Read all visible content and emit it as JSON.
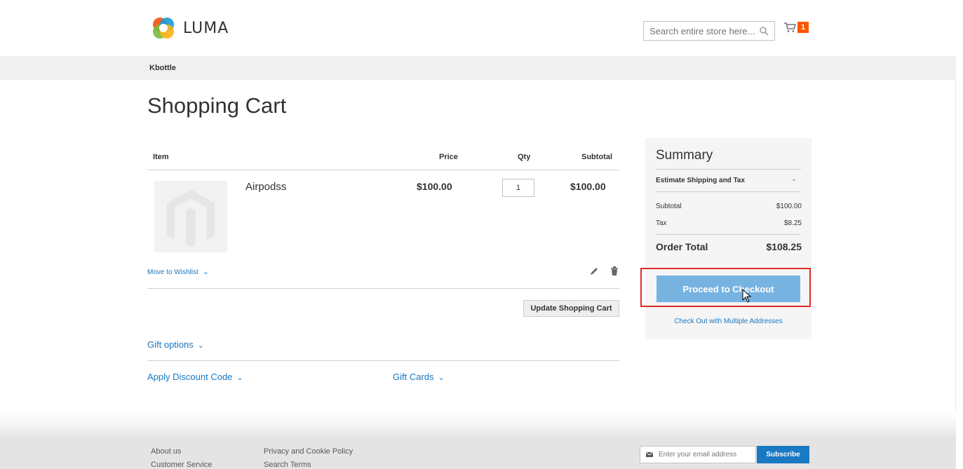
{
  "header": {
    "logo_text": "LUMA",
    "search_placeholder": "Search entire store here...",
    "cart_count": "1"
  },
  "nav": {
    "items": [
      "Kbottle"
    ]
  },
  "page": {
    "title": "Shopping Cart"
  },
  "cart": {
    "columns": [
      "Item",
      "Price",
      "Qty",
      "Subtotal"
    ],
    "items": [
      {
        "name": "Airpodss",
        "price": "$100.00",
        "qty": "1",
        "subtotal": "$100.00"
      }
    ],
    "move_to_wishlist": "Move to Wishlist",
    "update_button": "Update Shopping Cart",
    "gift_options": "Gift options",
    "apply_discount": "Apply Discount Code",
    "gift_cards": "Gift Cards"
  },
  "summary": {
    "title": "Summary",
    "estimate_shipping": "Estimate Shipping and Tax",
    "subtotal_label": "Subtotal",
    "subtotal_value": "$100.00",
    "tax_label": "Tax",
    "tax_value": "$8.25",
    "order_total_label": "Order Total",
    "order_total_value": "$108.25",
    "checkout_button": "Proceed to Checkout",
    "multi_address_link": "Check Out with Multiple Addresses"
  },
  "footer": {
    "links_col1": [
      "About us",
      "Customer Service"
    ],
    "links_col2": [
      "Privacy and Cookie Policy",
      "Search Terms"
    ],
    "newsletter_placeholder": "Enter your email address",
    "subscribe_button": "Subscribe"
  },
  "colors": {
    "accent": "#1979c3",
    "checkout_button": "#77b3e0",
    "cart_counter": "#ff5501",
    "highlight_border": "#e02b27"
  }
}
